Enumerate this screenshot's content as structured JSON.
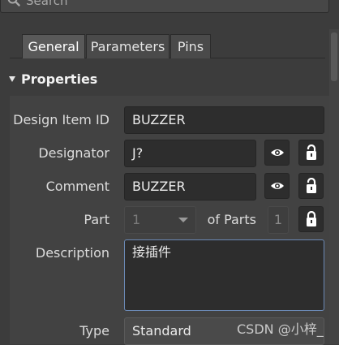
{
  "search": {
    "placeholder": "Search",
    "icon": "search-icon"
  },
  "tabs": [
    {
      "label": "General",
      "active": true
    },
    {
      "label": "Parameters",
      "active": false
    },
    {
      "label": "Pins",
      "active": false
    }
  ],
  "section": {
    "title": "Properties",
    "icon": "collapse-triangle-icon"
  },
  "properties": {
    "design_item_id": {
      "label": "Design Item ID",
      "value": "BUZZER"
    },
    "designator": {
      "label": "Designator",
      "value": "J?",
      "visibility_icon": "eye-icon",
      "lock_icon": "unlocked-padlock-icon"
    },
    "comment": {
      "label": "Comment",
      "value": "BUZZER",
      "visibility_icon": "eye-icon",
      "lock_icon": "unlocked-padlock-icon"
    },
    "part": {
      "label": "Part",
      "value": "1",
      "of_parts_label": "of Parts",
      "of_parts_value": "1",
      "lock_icon": "locked-padlock-icon"
    },
    "description": {
      "label": "Description",
      "value": "接插件"
    },
    "type": {
      "label": "Type",
      "value": "Standard"
    }
  },
  "watermark": "CSDN @小梓_",
  "colors": {
    "background": "#3c3c3c",
    "field": "#2d2d2d",
    "focus_border": "#6b89b5",
    "text": "#e6e6e6"
  }
}
